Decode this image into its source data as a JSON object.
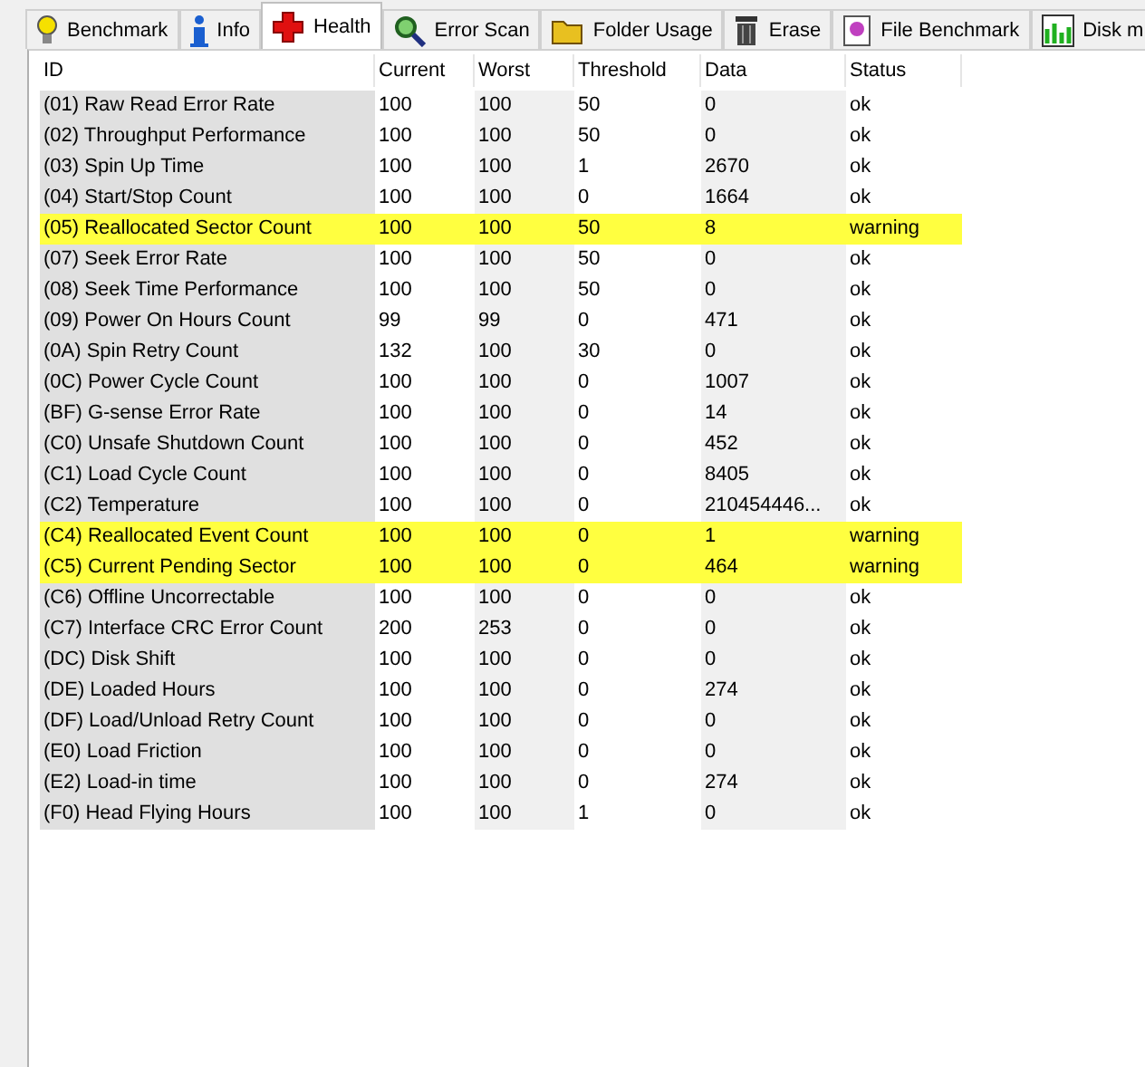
{
  "tabs": [
    {
      "label": "Benchmark",
      "selected": false
    },
    {
      "label": "Info",
      "selected": false
    },
    {
      "label": "Health",
      "selected": true
    },
    {
      "label": "Error Scan",
      "selected": false
    },
    {
      "label": "Folder Usage",
      "selected": false
    },
    {
      "label": "Erase",
      "selected": false
    },
    {
      "label": "File Benchmark",
      "selected": false
    },
    {
      "label": "Disk m",
      "selected": false
    }
  ],
  "table": {
    "columns": [
      "ID",
      "Current",
      "Worst",
      "Threshold",
      "Data",
      "Status"
    ],
    "rows": [
      {
        "cells": [
          "(01) Raw Read Error Rate",
          "100",
          "100",
          "50",
          "0",
          "ok"
        ],
        "warning": false
      },
      {
        "cells": [
          "(02) Throughput Performance",
          "100",
          "100",
          "50",
          "0",
          "ok"
        ],
        "warning": false
      },
      {
        "cells": [
          "(03) Spin Up Time",
          "100",
          "100",
          "1",
          "2670",
          "ok"
        ],
        "warning": false
      },
      {
        "cells": [
          "(04) Start/Stop Count",
          "100",
          "100",
          "0",
          "1664",
          "ok"
        ],
        "warning": false
      },
      {
        "cells": [
          "(05) Reallocated Sector Count",
          "100",
          "100",
          "50",
          "8",
          "warning"
        ],
        "warning": true
      },
      {
        "cells": [
          "(07) Seek Error Rate",
          "100",
          "100",
          "50",
          "0",
          "ok"
        ],
        "warning": false
      },
      {
        "cells": [
          "(08) Seek Time Performance",
          "100",
          "100",
          "50",
          "0",
          "ok"
        ],
        "warning": false
      },
      {
        "cells": [
          "(09) Power On Hours Count",
          "99",
          "99",
          "0",
          "471",
          "ok"
        ],
        "warning": false
      },
      {
        "cells": [
          "(0A) Spin Retry Count",
          "132",
          "100",
          "30",
          "0",
          "ok"
        ],
        "warning": false
      },
      {
        "cells": [
          "(0C) Power Cycle Count",
          "100",
          "100",
          "0",
          "1007",
          "ok"
        ],
        "warning": false
      },
      {
        "cells": [
          "(BF) G-sense Error Rate",
          "100",
          "100",
          "0",
          "14",
          "ok"
        ],
        "warning": false
      },
      {
        "cells": [
          "(C0) Unsafe Shutdown Count",
          "100",
          "100",
          "0",
          "452",
          "ok"
        ],
        "warning": false
      },
      {
        "cells": [
          "(C1) Load Cycle Count",
          "100",
          "100",
          "0",
          "8405",
          "ok"
        ],
        "warning": false
      },
      {
        "cells": [
          "(C2) Temperature",
          "100",
          "100",
          "0",
          "210454446...",
          "ok"
        ],
        "warning": false
      },
      {
        "cells": [
          "(C4) Reallocated Event Count",
          "100",
          "100",
          "0",
          "1",
          "warning"
        ],
        "warning": true
      },
      {
        "cells": [
          "(C5) Current Pending Sector",
          "100",
          "100",
          "0",
          "464",
          "warning"
        ],
        "warning": true
      },
      {
        "cells": [
          "(C6) Offline Uncorrectable",
          "100",
          "100",
          "0",
          "0",
          "ok"
        ],
        "warning": false
      },
      {
        "cells": [
          "(C7) Interface CRC Error Count",
          "200",
          "253",
          "0",
          "0",
          "ok"
        ],
        "warning": false
      },
      {
        "cells": [
          "(DC) Disk Shift",
          "100",
          "100",
          "0",
          "0",
          "ok"
        ],
        "warning": false
      },
      {
        "cells": [
          "(DE) Loaded Hours",
          "100",
          "100",
          "0",
          "274",
          "ok"
        ],
        "warning": false
      },
      {
        "cells": [
          "(DF) Load/Unload Retry Count",
          "100",
          "100",
          "0",
          "0",
          "ok"
        ],
        "warning": false
      },
      {
        "cells": [
          "(E0) Load Friction",
          "100",
          "100",
          "0",
          "0",
          "ok"
        ],
        "warning": false
      },
      {
        "cells": [
          "(E2) Load-in time",
          "100",
          "100",
          "0",
          "274",
          "ok"
        ],
        "warning": false
      },
      {
        "cells": [
          "(F0) Head Flying Hours",
          "100",
          "100",
          "1",
          "0",
          "ok"
        ],
        "warning": false
      }
    ]
  }
}
